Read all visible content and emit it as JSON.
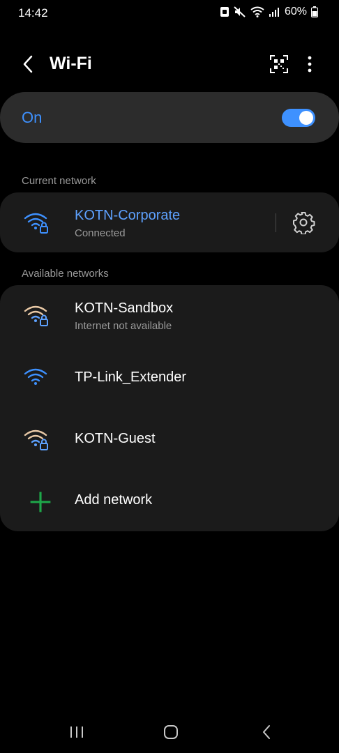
{
  "status_bar": {
    "time": "14:42",
    "battery": "60%"
  },
  "app_bar": {
    "title": "Wi-Fi"
  },
  "master_switch": {
    "label": "On",
    "enabled": true,
    "accent_color": "#3e91ff"
  },
  "current_network": {
    "header": "Current network",
    "name": "KOTN-Corporate",
    "status": "Connected",
    "icon": "wifi-lock-icon"
  },
  "available_networks": {
    "header": "Available networks",
    "items": [
      {
        "name": "KOTN-Sandbox",
        "status": "Internet not available",
        "icon": "wifi-lock-icon",
        "signal_color": "#e9c9a6"
      },
      {
        "name": "TP-Link_Extender",
        "status": "",
        "icon": "wifi-icon",
        "signal_color": "#3e91ff"
      },
      {
        "name": "KOTN-Guest",
        "status": "",
        "icon": "wifi-lock-icon",
        "signal_color": "#e9c9a6"
      }
    ],
    "add_label": "Add network"
  }
}
